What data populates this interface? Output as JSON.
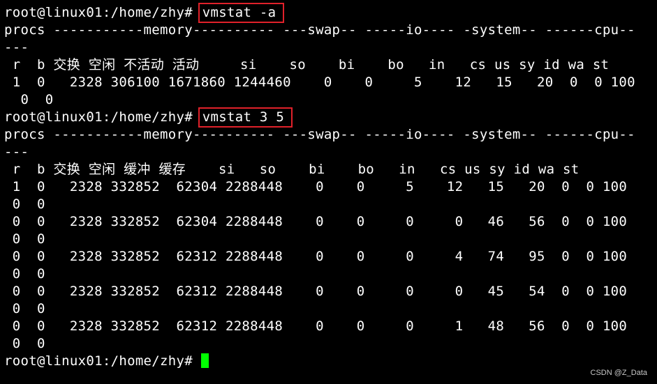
{
  "prompt": "root@linux01:/home/zhy# ",
  "command1": "vmstat -a",
  "output1": [
    "procs -----------memory---------- ---swap-- -----io---- -system-- ------cpu--",
    "---",
    " r  b 交换 空闲 不活动 活动     si    so    bi    bo   in   cs us sy id wa st",
    " 1  0   2328 306100 1671860 1244460    0    0     5    12   15   20  0  0 100",
    "  0  0"
  ],
  "command2": "vmstat 3 5",
  "output2": [
    "procs -----------memory---------- ---swap-- -----io---- -system-- ------cpu--",
    "---",
    " r  b 交换 空闲 缓冲 缓存    si   so    bi    bo   in   cs us sy id wa st",
    " 1  0   2328 332852  62304 2288448    0    0     5    12   15   20  0  0 100",
    " 0  0",
    " 0  0   2328 332852  62304 2288448    0    0     0     0   46   56  0  0 100",
    " 0  0",
    " 0  0   2328 332852  62312 2288448    0    0     0     4   74   95  0  0 100",
    " 0  0",
    " 0  0   2328 332852  62312 2288448    0    0     0     0   45   54  0  0 100",
    " 0  0",
    " 0  0   2328 332852  62312 2288448    0    0     0     1   48   56  0  0 100",
    " 0  0"
  ],
  "watermark": "CSDN @Z_Data"
}
